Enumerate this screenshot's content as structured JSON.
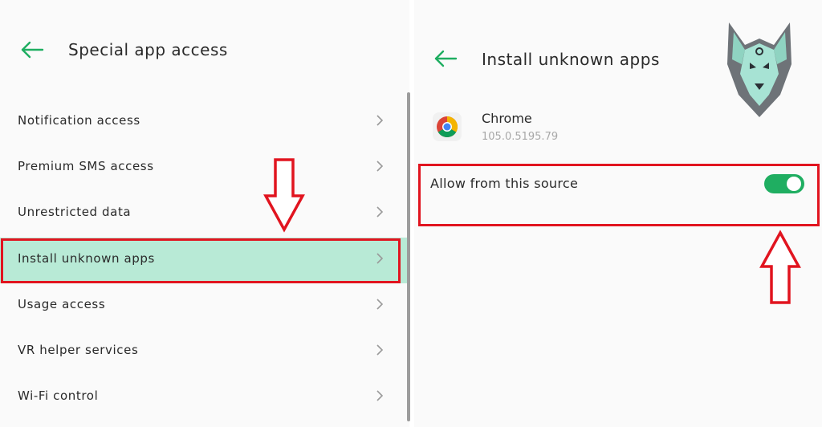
{
  "left_screen": {
    "title": "Special app access",
    "back_icon": "arrow-left-icon",
    "items": [
      {
        "label": "Notification access"
      },
      {
        "label": "Premium SMS access"
      },
      {
        "label": "Unrestricted data"
      },
      {
        "label": "Install unknown apps",
        "highlighted": true
      },
      {
        "label": "Usage access"
      },
      {
        "label": "VR helper services"
      },
      {
        "label": "Wi-Fi control"
      }
    ],
    "chevron_icon": "chevron-right-icon"
  },
  "right_screen": {
    "title": "Install unknown apps",
    "back_icon": "arrow-left-icon",
    "app": {
      "name": "Chrome",
      "version": "105.0.5195.79",
      "icon": "chrome-logo-icon"
    },
    "setting": {
      "label": "Allow from this source",
      "enabled": true
    }
  },
  "annotations": {
    "arrow_down_icon": "red-arrow-down-icon",
    "arrow_up_icon": "red-arrow-up-icon",
    "highlight_color": "#e1141f"
  },
  "colors": {
    "accent_green": "#1fae61",
    "highlight_bg": "#b8ead6",
    "text": "#2a2a2a",
    "muted": "#a8a8a8"
  }
}
